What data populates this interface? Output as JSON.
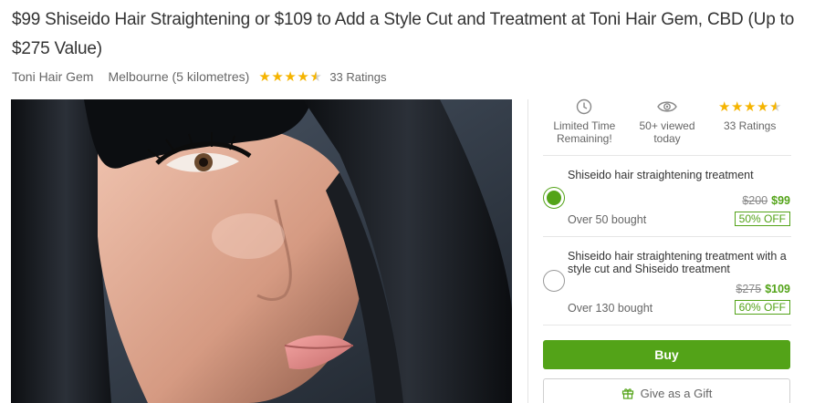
{
  "deal": {
    "title": "$99 Shiseido Hair Straightening or $109 to Add a Style Cut and Treatment at Toni Hair Gem, CBD (Up to $275 Value)",
    "merchant": "Toni Hair Gem",
    "location": "Melbourne (5 kilometres)",
    "rating": 4.5,
    "rating_text": "33 Ratings"
  },
  "hero": {
    "alt": "Woman with long straight black hair"
  },
  "features": [
    {
      "icon": "clock-icon",
      "line1": "Limited Time",
      "line2": "Remaining!"
    },
    {
      "icon": "eye-icon",
      "line1": "50+ viewed",
      "line2": "today"
    },
    {
      "icon": "stars-icon",
      "line1": "",
      "line2": "33 Ratings"
    }
  ],
  "options": [
    {
      "name": "Shiseido hair straightening treatment",
      "original_price": "$200",
      "price": "$99",
      "bought": "Over 50 bought",
      "discount": "50% OFF",
      "selected": true
    },
    {
      "name": "Shiseido hair straightening treatment with a style cut and Shiseido treatment",
      "original_price": "$275",
      "price": "$109",
      "bought": "Over 130 bought",
      "discount": "60% OFF",
      "selected": false
    }
  ],
  "actions": {
    "buy_label": "Buy",
    "gift_label": "Give as a Gift"
  },
  "colors": {
    "accent": "#53a318",
    "star": "#f5b400"
  }
}
